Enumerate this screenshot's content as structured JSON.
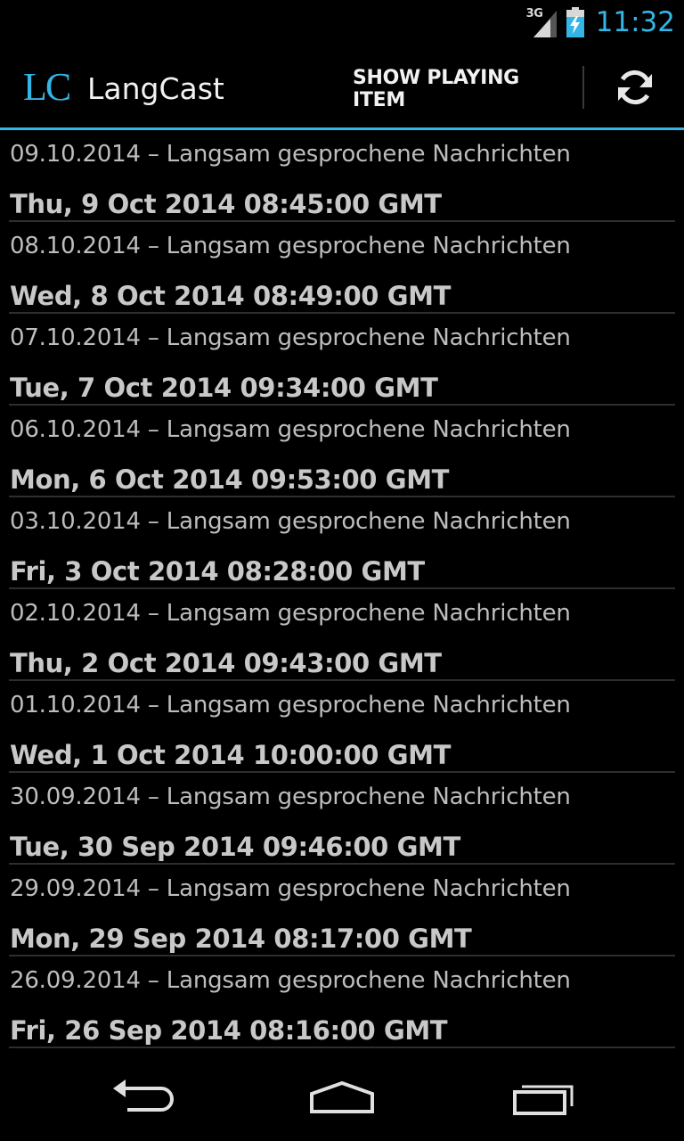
{
  "status_bar": {
    "network": "3G",
    "time": "11:32"
  },
  "action_bar": {
    "logo": "LC",
    "title": "LangCast",
    "show_playing_label": "SHOW PLAYING ITEM",
    "refresh_icon": "refresh-icon"
  },
  "items": [
    {
      "title": "09.10.2014 – Langsam gesprochene Nachrichten",
      "date": "Thu, 9 Oct 2014 08:45:00 GMT"
    },
    {
      "title": "08.10.2014 – Langsam gesprochene Nachrichten",
      "date": "Wed, 8 Oct 2014 08:49:00 GMT"
    },
    {
      "title": "07.10.2014 – Langsam gesprochene Nachrichten",
      "date": "Tue, 7 Oct 2014 09:34:00 GMT"
    },
    {
      "title": "06.10.2014 – Langsam gesprochene Nachrichten",
      "date": "Mon, 6 Oct 2014 09:53:00 GMT"
    },
    {
      "title": "03.10.2014 – Langsam gesprochene Nachrichten",
      "date": "Fri, 3 Oct 2014 08:28:00 GMT"
    },
    {
      "title": "02.10.2014 – Langsam gesprochene Nachrichten",
      "date": "Thu, 2 Oct 2014 09:43:00 GMT"
    },
    {
      "title": "01.10.2014 – Langsam gesprochene Nachrichten",
      "date": "Wed, 1 Oct 2014 10:00:00 GMT"
    },
    {
      "title": "30.09.2014 – Langsam gesprochene Nachrichten",
      "date": "Tue, 30 Sep 2014 09:46:00 GMT"
    },
    {
      "title": "29.09.2014 – Langsam gesprochene Nachrichten",
      "date": "Mon, 29 Sep 2014 08:17:00 GMT"
    },
    {
      "title": "26.09.2014 – Langsam gesprochene Nachrichten",
      "date": "Fri, 26 Sep 2014 08:16:00 GMT"
    }
  ],
  "nav_bar": {
    "back_icon": "back-icon",
    "home_icon": "home-icon",
    "recents_icon": "recent-apps-icon"
  },
  "colors": {
    "accent": "#33b5e5",
    "background": "#000000"
  }
}
